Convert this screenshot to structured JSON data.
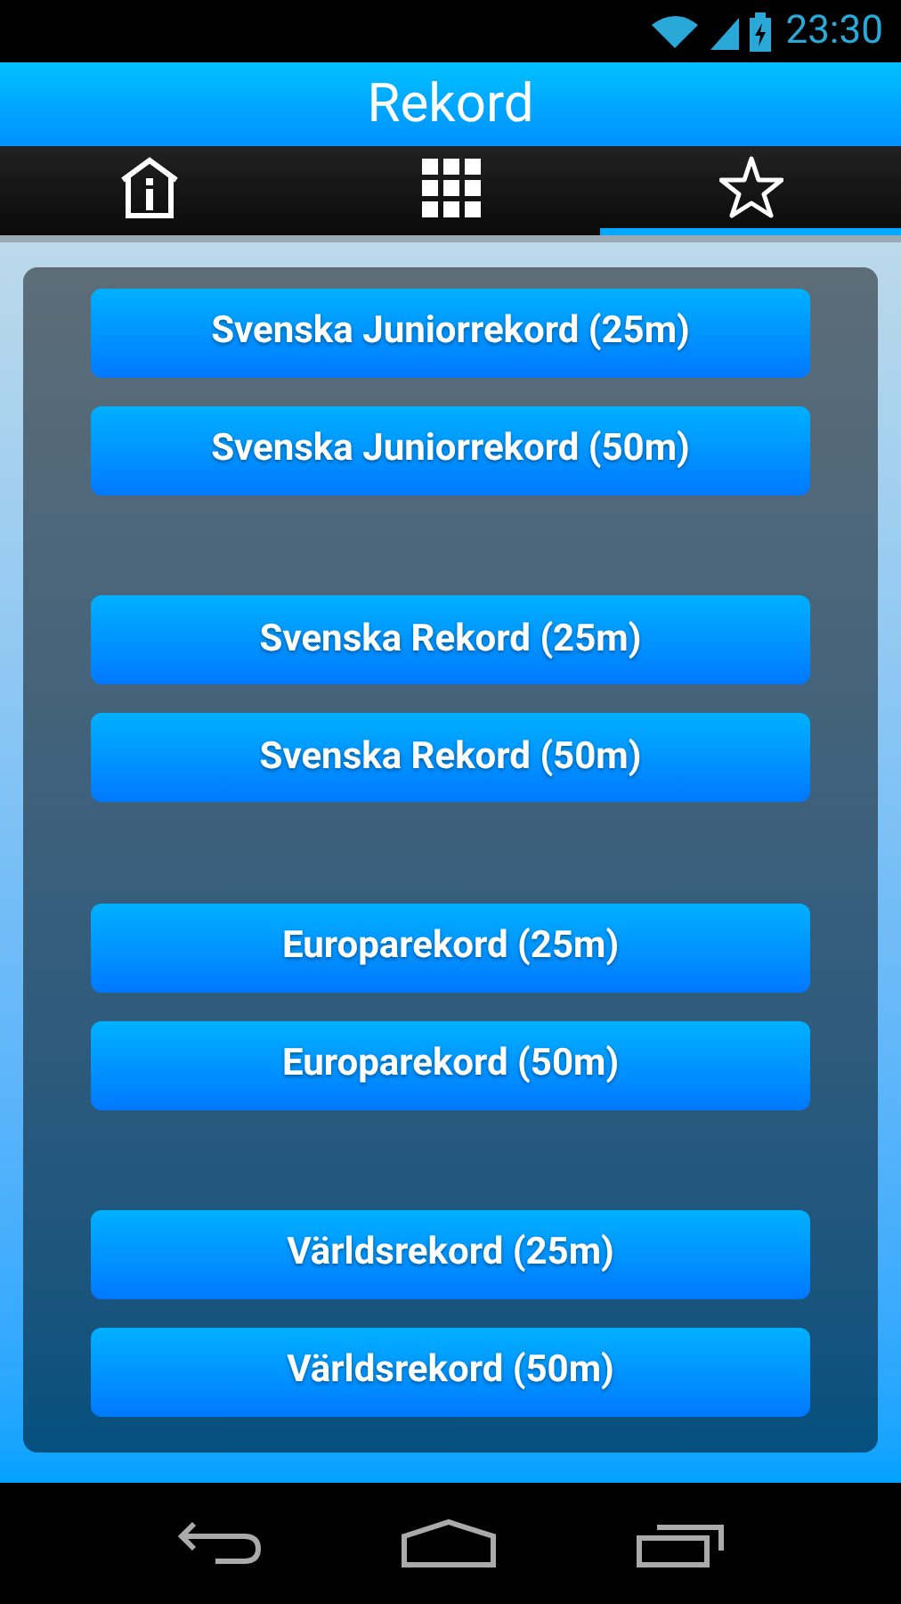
{
  "status_bar": {
    "time": "23:30"
  },
  "title": "Rekord",
  "tabs": [
    {
      "kind": "info",
      "selected": false
    },
    {
      "kind": "grid",
      "selected": false
    },
    {
      "kind": "star",
      "selected": true
    }
  ],
  "button_groups": [
    [
      "Svenska Juniorrekord (25m)",
      "Svenska Juniorrekord (50m)"
    ],
    [
      "Svenska Rekord (25m)",
      "Svenska Rekord (50m)"
    ],
    [
      "Europarekord (25m)",
      "Europarekord (50m)"
    ],
    [
      "Världsrekord (25m)",
      "Världsrekord (50m)"
    ]
  ]
}
